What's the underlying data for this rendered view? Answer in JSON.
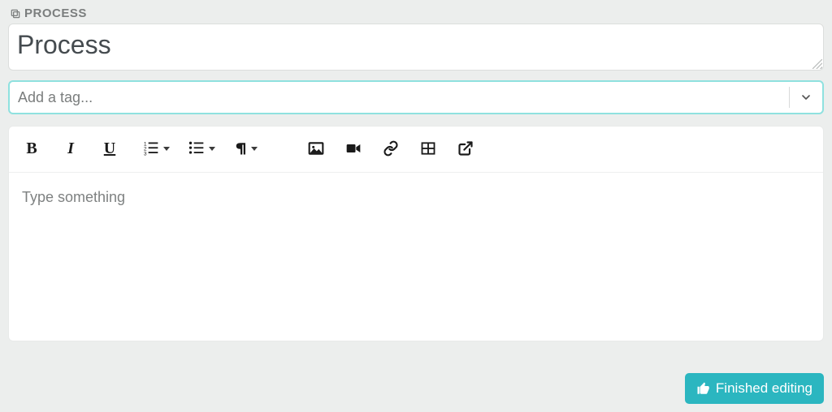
{
  "section": {
    "label": "PROCESS"
  },
  "title": {
    "value": "Process"
  },
  "tag": {
    "placeholder": "Add a tag..."
  },
  "editor": {
    "placeholder": "Type something",
    "toolbar": {
      "bold": "B",
      "italic": "I",
      "underline": "U"
    }
  },
  "actions": {
    "finish": "Finished editing"
  }
}
